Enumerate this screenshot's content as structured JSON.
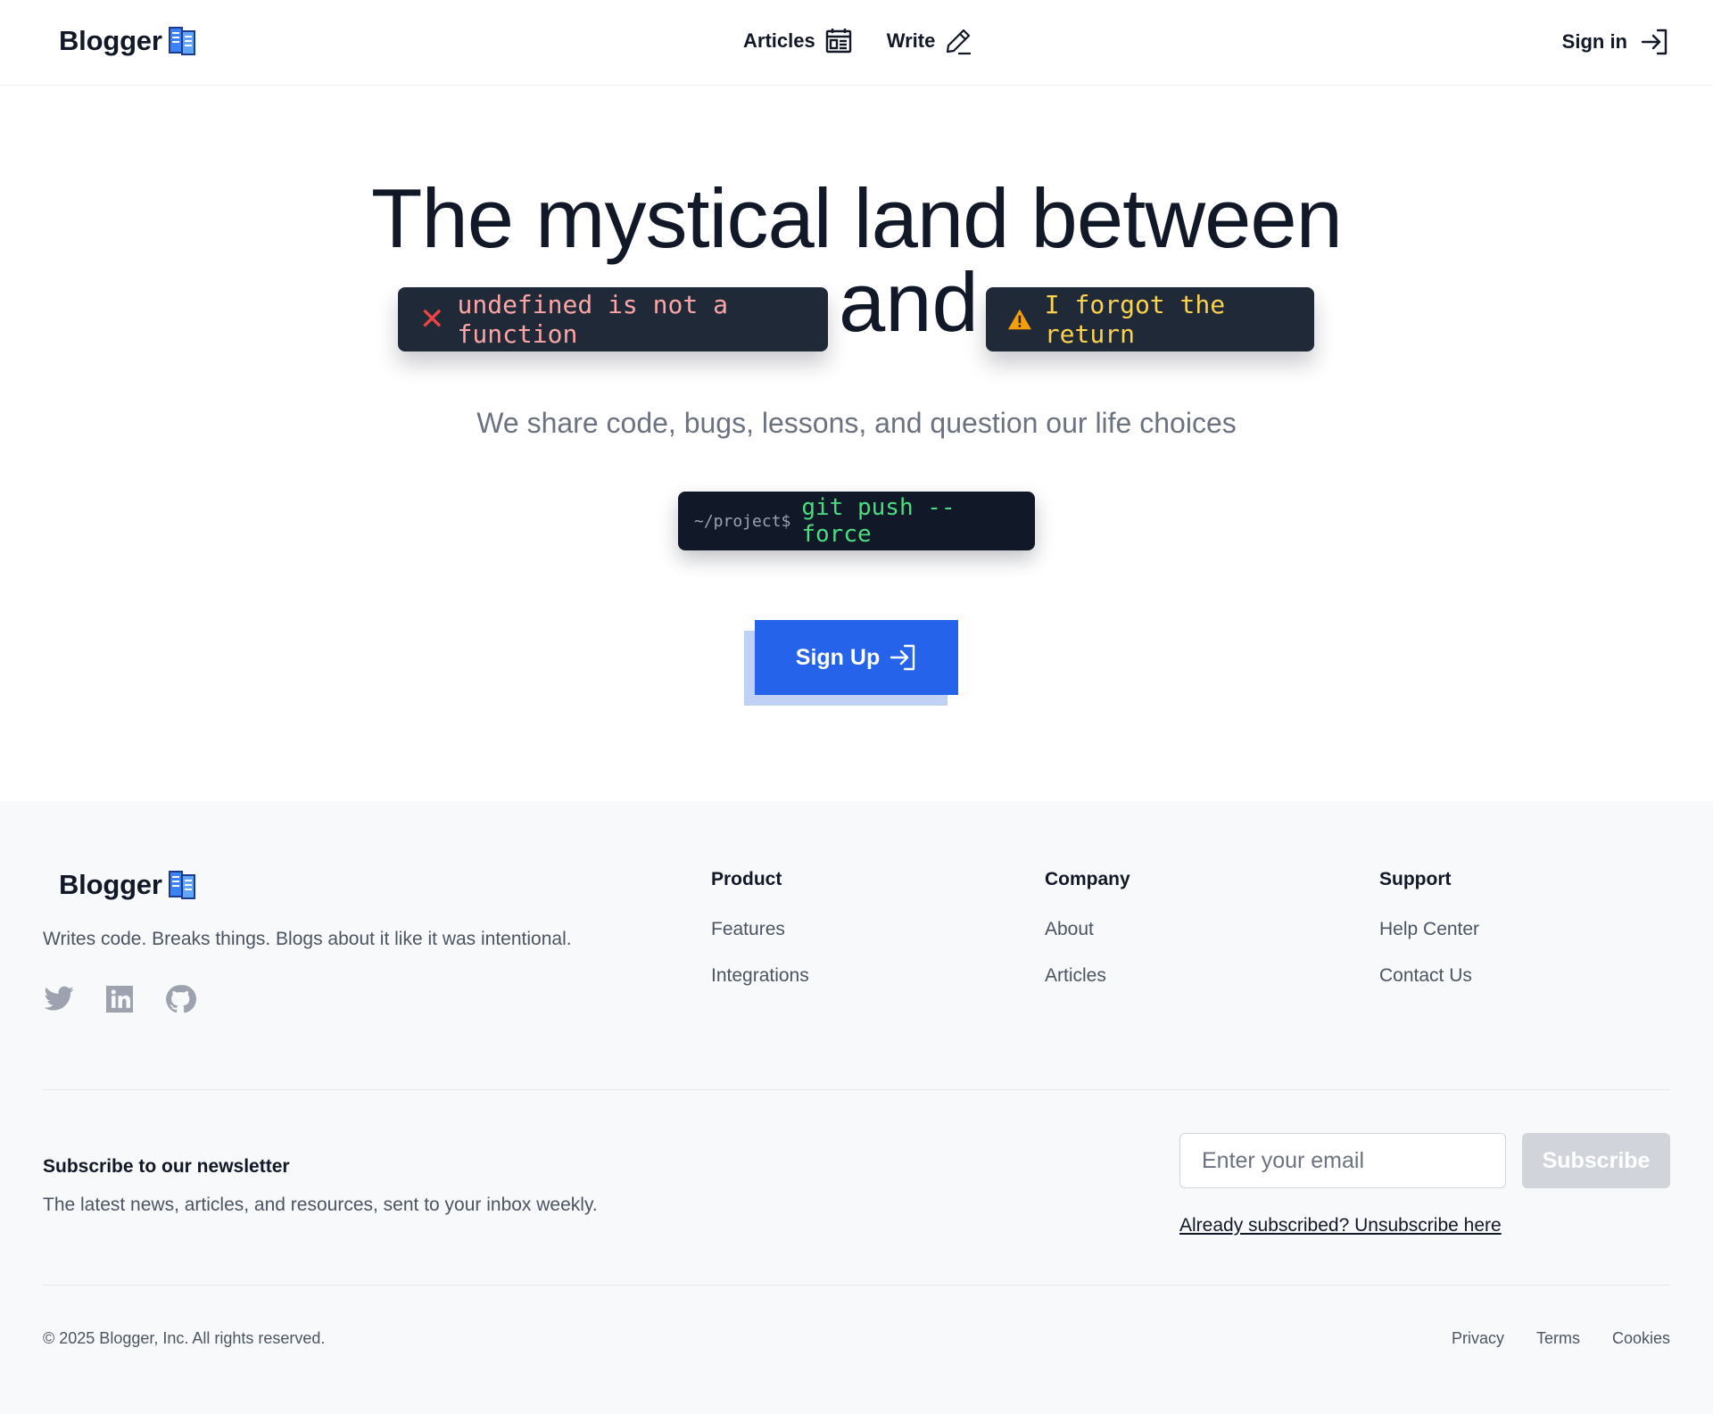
{
  "brand": {
    "name": "Blogger",
    "icon": "book-icon"
  },
  "nav": {
    "articles_label": "Articles",
    "write_label": "Write",
    "signin_label": "Sign in"
  },
  "hero": {
    "line1": "The mystical land between",
    "and_word": "and",
    "error_chip": "undefined is not a function",
    "warn_chip": "I forgot the return",
    "tagline": "We share code, bugs, lessons, and question our life choices",
    "terminal_prompt": "~/project$",
    "terminal_cmd": "git push --force",
    "signup_label": "Sign Up"
  },
  "footer": {
    "description": "Writes code. Breaks things. Blogs about it like it was intentional.",
    "columns": [
      {
        "title": "Product",
        "links": [
          "Features",
          "Integrations"
        ]
      },
      {
        "title": "Company",
        "links": [
          "About",
          "Articles"
        ]
      },
      {
        "title": "Support",
        "links": [
          "Help Center",
          "Contact Us"
        ]
      }
    ],
    "newsletter": {
      "title": "Subscribe to our newsletter",
      "description": "The latest news, articles, and resources, sent to your inbox weekly.",
      "email_placeholder": "Enter your email",
      "subscribe_label": "Subscribe",
      "unsubscribe_label": "Already subscribed? Unsubscribe here"
    },
    "copyright": "© 2025 Blogger, Inc. All rights reserved.",
    "legal": [
      "Privacy",
      "Terms",
      "Cookies"
    ]
  },
  "colors": {
    "accent": "#2563eb",
    "error": "#ef4444",
    "warning": "#f59e0b",
    "terminal_green": "#4ade80"
  }
}
